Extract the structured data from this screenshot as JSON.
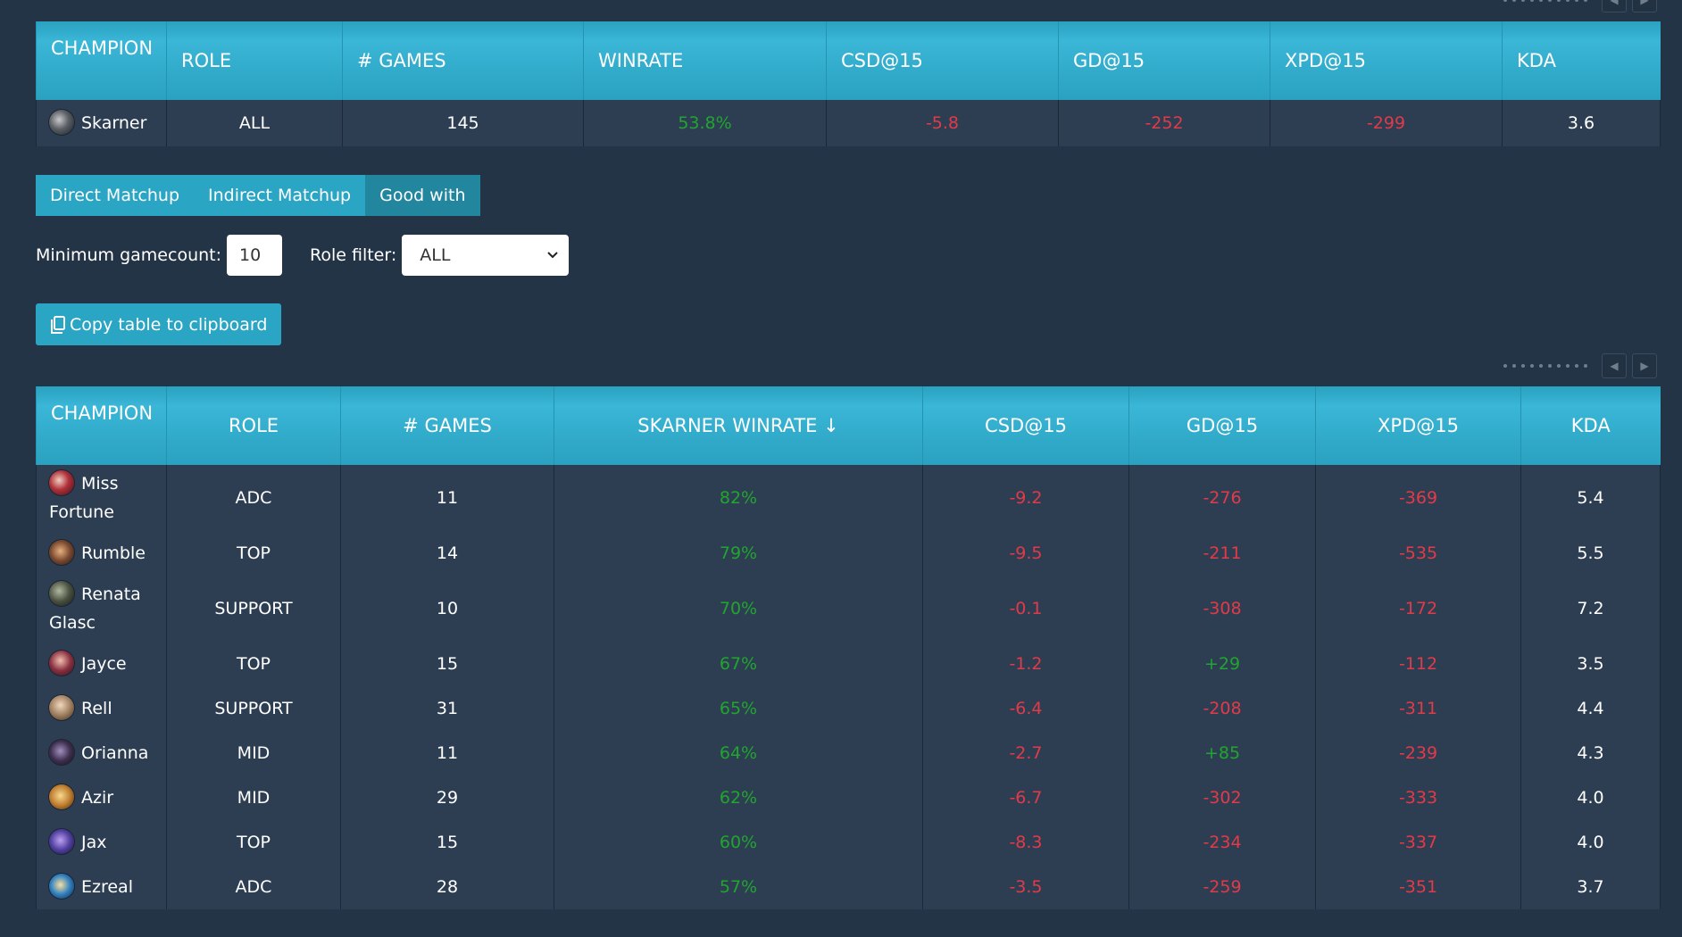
{
  "summary": {
    "headers": [
      "CHAMPION",
      "ROLE",
      "# GAMES",
      "WINRATE",
      "CSD@15",
      "GD@15",
      "XPD@15",
      "KDA"
    ],
    "row": {
      "champion": "Skarner",
      "role": "ALL",
      "games": "145",
      "winrate": "53.8%",
      "csd": "-5.8",
      "gd": "-252",
      "xpd": "-299",
      "kda": "3.6"
    }
  },
  "tabs": {
    "direct": "Direct Matchup",
    "indirect": "Indirect Matchup",
    "good_with": "Good with"
  },
  "filters": {
    "min_gamecount_label": "Minimum gamecount:",
    "min_gamecount_value": "10",
    "role_filter_label": "Role filter:",
    "role_filter_value": "ALL"
  },
  "copy_button": {
    "label": "Copy table to clipboard"
  },
  "table": {
    "headers": [
      "CHAMPION",
      "ROLE",
      "# GAMES",
      "SKARNER WINRATE ↓",
      "CSD@15",
      "GD@15",
      "XPD@15",
      "KDA"
    ],
    "rows": [
      {
        "champion": "Miss Fortune",
        "role": "ADC",
        "games": "11",
        "winrate": "82%",
        "csd": "-9.2",
        "gd": "-276",
        "xpd": "-369",
        "kda": "5.4"
      },
      {
        "champion": "Rumble",
        "role": "TOP",
        "games": "14",
        "winrate": "79%",
        "csd": "-9.5",
        "gd": "-211",
        "xpd": "-535",
        "kda": "5.5"
      },
      {
        "champion": "Renata Glasc",
        "role": "SUPPORT",
        "games": "10",
        "winrate": "70%",
        "csd": "-0.1",
        "gd": "-308",
        "xpd": "-172",
        "kda": "7.2"
      },
      {
        "champion": "Jayce",
        "role": "TOP",
        "games": "15",
        "winrate": "67%",
        "csd": "-1.2",
        "gd": "+29",
        "xpd": "-112",
        "kda": "3.5"
      },
      {
        "champion": "Rell",
        "role": "SUPPORT",
        "games": "31",
        "winrate": "65%",
        "csd": "-6.4",
        "gd": "-208",
        "xpd": "-311",
        "kda": "4.4"
      },
      {
        "champion": "Orianna",
        "role": "MID",
        "games": "11",
        "winrate": "64%",
        "csd": "-2.7",
        "gd": "+85",
        "xpd": "-239",
        "kda": "4.3"
      },
      {
        "champion": "Azir",
        "role": "MID",
        "games": "29",
        "winrate": "62%",
        "csd": "-6.7",
        "gd": "-302",
        "xpd": "-333",
        "kda": "4.0"
      },
      {
        "champion": "Jax",
        "role": "TOP",
        "games": "15",
        "winrate": "60%",
        "csd": "-8.3",
        "gd": "-234",
        "xpd": "-337",
        "kda": "4.0"
      },
      {
        "champion": "Ezreal",
        "role": "ADC",
        "games": "28",
        "winrate": "57%",
        "csd": "-3.5",
        "gd": "-259",
        "xpd": "-351",
        "kda": "3.7"
      }
    ]
  },
  "colors": {
    "positive": "#21a52f",
    "negative": "#e23a48",
    "header_bg": "#2aa1c0",
    "row_bg": "#2d3e53",
    "page_bg": "#243447"
  }
}
